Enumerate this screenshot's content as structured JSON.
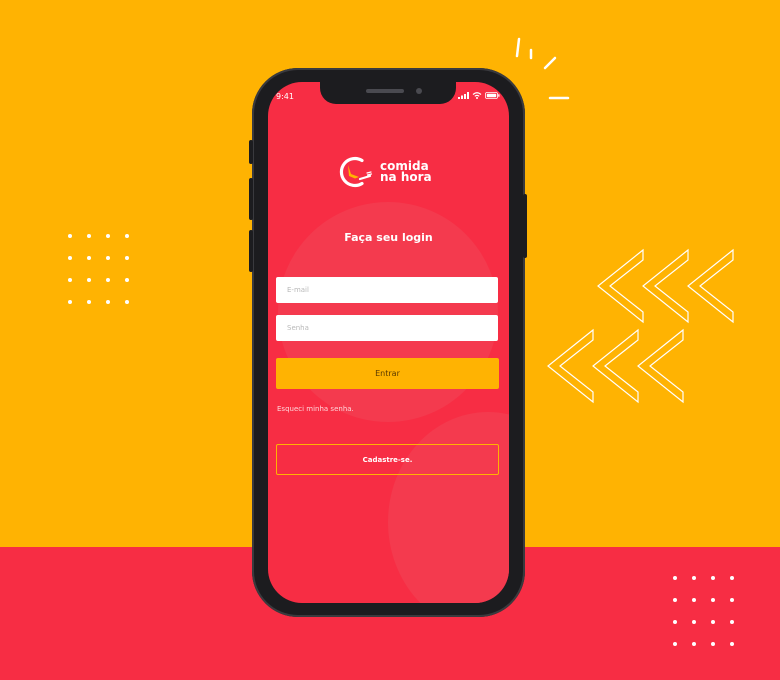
{
  "status_bar": {
    "time": "9:41"
  },
  "brand": {
    "line1": "comida",
    "line2": "na hora"
  },
  "login": {
    "title": "Faça seu login",
    "email_placeholder": "E-mail",
    "password_placeholder": "Senha",
    "submit_label": "Entrar",
    "forgot_label": "Esqueci minha senha.",
    "signup_label": "Cadastre-se."
  },
  "colors": {
    "background": "#ffb302",
    "accent_red": "#f72d44",
    "button_yellow": "#ffb302"
  }
}
